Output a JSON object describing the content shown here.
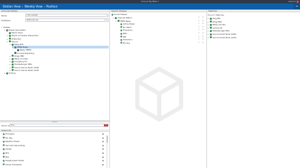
{
  "window": {
    "title": "Channel Tag Mater 1",
    "user": "Lawrence"
  },
  "breadcrumb": {
    "items": [
      "Station View",
      "Weekly View",
      "Position"
    ],
    "separator": "›"
  },
  "header_action": "Go",
  "left_panel": {
    "title": "Channel Details",
    "fields": [
      {
        "label": "Name",
        "value": "ChannelsSet",
        "dropdown": "▾"
      },
      {
        "label": "Database",
        "value": "StationGroup",
        "dropdown": "▾ ✕"
      }
    ],
    "section_label": "Details",
    "tree": [
      {
        "label": "Power Generation",
        "indent": 1,
        "toggle": "▾",
        "icon": "o"
      },
      {
        "label": "Fabric Feed",
        "indent": 2,
        "toggle": "",
        "icon": "g"
      },
      {
        "label": "Power Controller Equipment",
        "indent": 2,
        "toggle": "▸",
        "icon": "g"
      },
      {
        "label": "Protection",
        "indent": 2,
        "toggle": "▸",
        "icon": "g"
      },
      {
        "label": "Sensor",
        "indent": 2,
        "toggle": "▾",
        "icon": "g"
      },
      {
        "label": "Relay-BTL",
        "indent": 3,
        "toggle": "▾",
        "icon": "g"
      },
      {
        "label": "HMW Relay",
        "indent": 4,
        "toggle": "▾",
        "icon": "g",
        "selected": true
      },
      {
        "label": "Relay HPRM",
        "indent": 5,
        "toggle": "",
        "icon": "b"
      },
      {
        "label": "Current Reporting",
        "indent": 4,
        "toggle": "",
        "icon": "b"
      },
      {
        "label": "Ringy BKC",
        "indent": 3,
        "toggle": "▸",
        "icon": "g"
      },
      {
        "label": "Relay Lorndes",
        "indent": 3,
        "toggle": "▸",
        "icon": "g"
      },
      {
        "label": "Liangping S3",
        "indent": 3,
        "toggle": "▸",
        "icon": "g"
      },
      {
        "label": "Hamesburger RPG",
        "indent": 3,
        "toggle": "▸",
        "icon": "g"
      },
      {
        "label": "Sound Carrier Bank (SCB)",
        "indent": 3,
        "toggle": "▸",
        "icon": "g"
      },
      {
        "label": "Sound Carrier Bank (ACD)",
        "indent": 3,
        "toggle": "▸",
        "icon": "g"
      },
      {
        "label": "Tooling",
        "indent": 1,
        "toggle": "▸",
        "icon": "g"
      }
    ],
    "filter": {
      "label": "Search by",
      "value": "Pins",
      "clear_label": "✕"
    },
    "list_title": "Select All",
    "list_items": [
      "Processor",
      "Pin Tag",
      "Relation Power",
      "Seconds Generating",
      "Assign",
      "BCL",
      "BCL",
      "Target power Power",
      "Cause Transients"
    ],
    "visibility_icon": "◉"
  },
  "middle_panel": {
    "title": "Search Shapes",
    "subtitle": "Found Shapes",
    "tools": "⤢ ✎",
    "shapes": [
      {
        "label": "Channel Station",
        "indent": 1,
        "toggle": "▾",
        "icon": "g"
      },
      {
        "label": "HMW Relay",
        "indent": 2,
        "toggle": "▾",
        "icon": "g"
      },
      {
        "label": "Active Power",
        "indent": 3,
        "toggle": "",
        "icon": "s"
      },
      {
        "label": "Pin Stack",
        "indent": 3,
        "toggle": "",
        "icon": "s"
      },
      {
        "label": "Frequency",
        "indent": 3,
        "toggle": "",
        "icon": "s"
      },
      {
        "label": "MPS",
        "indent": 3,
        "toggle": "",
        "icon": "s"
      },
      {
        "label": "RPL",
        "indent": 3,
        "toggle": "",
        "icon": "s"
      },
      {
        "label": "Protection",
        "indent": 3,
        "toggle": "",
        "icon": "s"
      },
      {
        "label": "Pinning",
        "indent": 3,
        "toggle": "",
        "icon": "s"
      }
    ]
  },
  "right_panel": {
    "title": "Matches",
    "summary": "Found 7 Matches",
    "matches": [
      "Ring BTL",
      "Ringy BKC",
      "Relay Lorndes",
      "Lidrand S3",
      "Hamesburger RPG",
      "Sound Carrier Bank (SCB)",
      "Sound Carrier Bank (ACD)"
    ]
  },
  "colors": {
    "accent": "#0e5ea8",
    "titlebar": "#2f3a49",
    "selection": "#bed8f2",
    "close": "#d9534f"
  }
}
